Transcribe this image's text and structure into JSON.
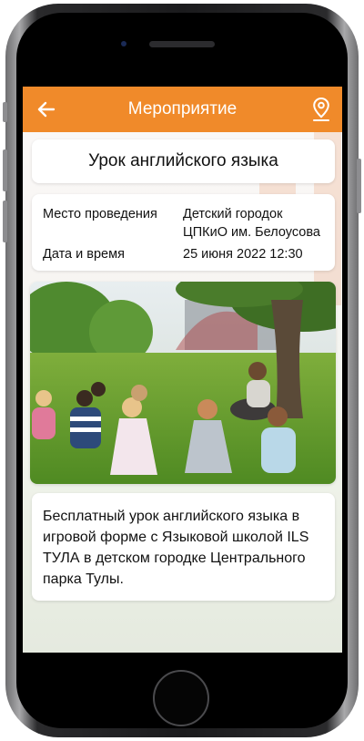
{
  "app_bar": {
    "title": "Мероприятие",
    "back_icon": "arrow-left-icon",
    "location_icon": "map-pin-icon",
    "color": "#f08a2a"
  },
  "event": {
    "title": "Урок английского языка",
    "venue_label": "Место проведения",
    "venue_value_line1": "Детский городок",
    "venue_value_line2": "ЦПКиО им. Белоусова",
    "datetime_label": "Дата и время",
    "datetime_value": "25 июня 2022 12:30",
    "photo": "children-sitting-in-circle-on-grass-with-teacher-photo",
    "description": "Бесплатный урок английского языка в игровой форме с Языковой школой ILS ТУЛА в детском городке Центрального парка Тулы."
  }
}
